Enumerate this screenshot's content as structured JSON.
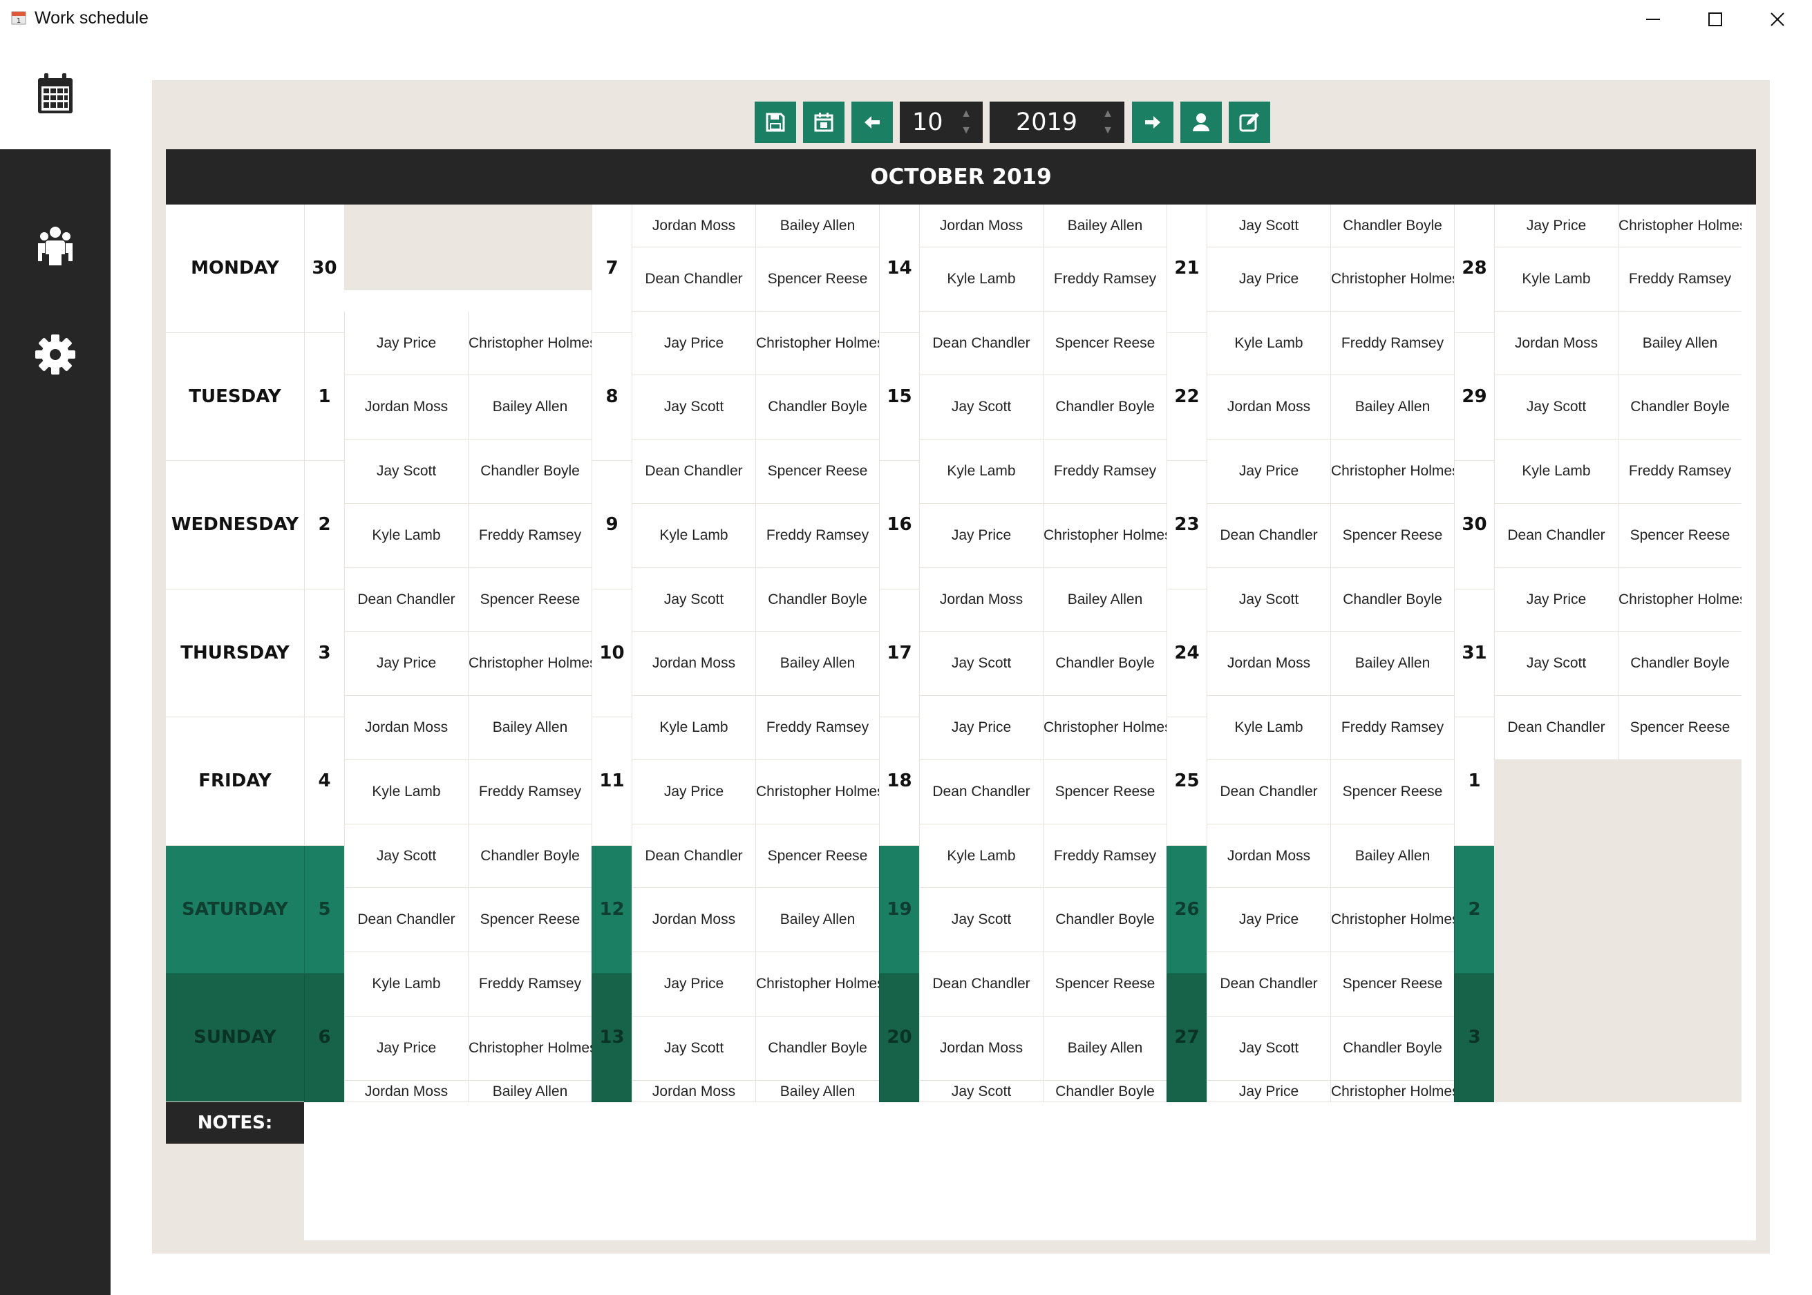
{
  "window": {
    "title": "Work schedule",
    "icon": "calendar-app-icon"
  },
  "sidebar": {
    "items": [
      {
        "name": "calendar",
        "icon": "calendar-icon",
        "active": true
      },
      {
        "name": "employees",
        "icon": "people-icon",
        "active": false
      },
      {
        "name": "settings",
        "icon": "gear-icon",
        "active": false
      }
    ]
  },
  "toolbar": {
    "month_value": "10",
    "year_value": "2019",
    "buttons": [
      "save-icon",
      "calendar-icon",
      "arrow-left-icon",
      "arrow-right-icon",
      "user-icon",
      "edit-icon"
    ]
  },
  "colors": {
    "accent": "#1b8063",
    "dark": "#262626",
    "panel": "#ebe7e0",
    "sunday": "#176349"
  },
  "schedule": {
    "month_title": "OCTOBER 2019",
    "days": [
      "MONDAY",
      "TUESDAY",
      "WEDNESDAY",
      "THURSDAY",
      "FRIDAY",
      "SATURDAY",
      "SUNDAY"
    ],
    "weeks": [
      {
        "dates": [
          "30",
          "1",
          "2",
          "3",
          "4",
          "5",
          "6"
        ],
        "names": [
          null,
          null,
          [
            "Jay Price",
            "Christopher Holmes"
          ],
          [
            "Jordan Moss",
            "Bailey Allen"
          ],
          [
            "Jay Scott",
            "Chandler Boyle"
          ],
          [
            "Kyle Lamb",
            "Freddy Ramsey"
          ],
          [
            "Dean Chandler",
            "Spencer Reese"
          ],
          [
            "Jay Price",
            "Christopher Holmes"
          ],
          [
            "Jordan Moss",
            "Bailey Allen"
          ],
          [
            "Kyle Lamb",
            "Freddy Ramsey"
          ],
          [
            "Jay Scott",
            "Chandler Boyle"
          ],
          [
            "Dean Chandler",
            "Spencer Reese"
          ],
          [
            "Kyle Lamb",
            "Freddy Ramsey"
          ],
          [
            "Jay Price",
            "Christopher Holmes"
          ],
          [
            "Jordan Moss",
            "Bailey Allen"
          ]
        ]
      },
      {
        "dates": [
          "7",
          "8",
          "9",
          "10",
          "11",
          "12",
          "13"
        ],
        "names": [
          [
            "Jordan Moss",
            "Bailey Allen"
          ],
          [
            "Dean Chandler",
            "Spencer Reese"
          ],
          [
            "Jay Price",
            "Christopher Holmes"
          ],
          [
            "Jay Scott",
            "Chandler Boyle"
          ],
          [
            "Dean Chandler",
            "Spencer Reese"
          ],
          [
            "Kyle Lamb",
            "Freddy Ramsey"
          ],
          [
            "Jay Scott",
            "Chandler Boyle"
          ],
          [
            "Jordan Moss",
            "Bailey Allen"
          ],
          [
            "Kyle Lamb",
            "Freddy Ramsey"
          ],
          [
            "Jay Price",
            "Christopher Holmes"
          ],
          [
            "Dean Chandler",
            "Spencer Reese"
          ],
          [
            "Jordan Moss",
            "Bailey Allen"
          ],
          [
            "Jay Price",
            "Christopher Holmes"
          ],
          [
            "Jay Scott",
            "Chandler Boyle"
          ],
          [
            "Jordan Moss",
            "Bailey Allen"
          ]
        ]
      },
      {
        "dates": [
          "14",
          "15",
          "16",
          "17",
          "18",
          "19",
          "20"
        ],
        "names": [
          [
            "Jordan Moss",
            "Bailey Allen"
          ],
          [
            "Kyle Lamb",
            "Freddy Ramsey"
          ],
          [
            "Dean Chandler",
            "Spencer Reese"
          ],
          [
            "Jay Scott",
            "Chandler Boyle"
          ],
          [
            "Kyle Lamb",
            "Freddy Ramsey"
          ],
          [
            "Jay Price",
            "Christopher Holmes"
          ],
          [
            "Jordan Moss",
            "Bailey Allen"
          ],
          [
            "Jay Scott",
            "Chandler Boyle"
          ],
          [
            "Jay Price",
            "Christopher Holmes"
          ],
          [
            "Dean Chandler",
            "Spencer Reese"
          ],
          [
            "Kyle Lamb",
            "Freddy Ramsey"
          ],
          [
            "Jay Scott",
            "Chandler Boyle"
          ],
          [
            "Dean Chandler",
            "Spencer Reese"
          ],
          [
            "Jordan Moss",
            "Bailey Allen"
          ],
          [
            "Jay Scott",
            "Chandler Boyle"
          ]
        ]
      },
      {
        "dates": [
          "21",
          "22",
          "23",
          "24",
          "25",
          "26",
          "27"
        ],
        "names": [
          [
            "Jay Scott",
            "Chandler Boyle"
          ],
          [
            "Jay Price",
            "Christopher Holmes"
          ],
          [
            "Kyle Lamb",
            "Freddy Ramsey"
          ],
          [
            "Jordan Moss",
            "Bailey Allen"
          ],
          [
            "Jay Price",
            "Christopher Holmes"
          ],
          [
            "Dean Chandler",
            "Spencer Reese"
          ],
          [
            "Jay Scott",
            "Chandler Boyle"
          ],
          [
            "Jordan Moss",
            "Bailey Allen"
          ],
          [
            "Kyle Lamb",
            "Freddy Ramsey"
          ],
          [
            "Dean Chandler",
            "Spencer Reese"
          ],
          [
            "Jordan Moss",
            "Bailey Allen"
          ],
          [
            "Jay Price",
            "Christopher Holmes"
          ],
          [
            "Dean Chandler",
            "Spencer Reese"
          ],
          [
            "Jay Scott",
            "Chandler Boyle"
          ],
          [
            "Jay Price",
            "Christopher Holmes"
          ]
        ]
      },
      {
        "dates": [
          "28",
          "29",
          "30",
          "31",
          "1",
          "2",
          "3"
        ],
        "names": [
          [
            "Jay Price",
            "Christopher Holmes"
          ],
          [
            "Kyle Lamb",
            "Freddy Ramsey"
          ],
          [
            "Jordan Moss",
            "Bailey Allen"
          ],
          [
            "Jay Scott",
            "Chandler Boyle"
          ],
          [
            "Kyle Lamb",
            "Freddy Ramsey"
          ],
          [
            "Dean Chandler",
            "Spencer Reese"
          ],
          [
            "Jay Price",
            "Christopher Holmes"
          ],
          [
            "Jay Scott",
            "Chandler Boyle"
          ],
          [
            "Dean Chandler",
            "Spencer Reese"
          ],
          null,
          null,
          null,
          null,
          null,
          null
        ]
      }
    ],
    "notes_label": "NOTES:",
    "notes_text": ""
  }
}
